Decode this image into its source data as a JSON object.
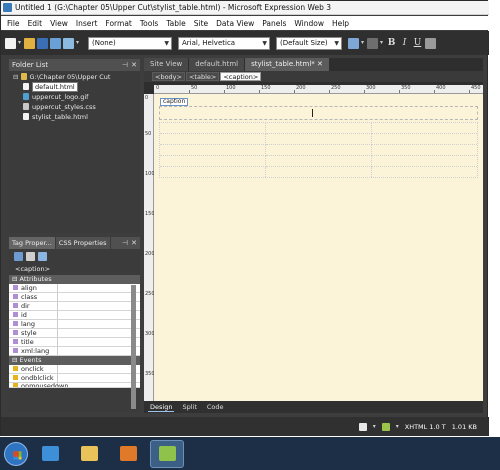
{
  "titlebar": {
    "title": "Untitled 1 (G:\\Chapter 05\\Upper Cut\\stylist_table.html) - Microsoft Expression Web 3"
  },
  "menu": [
    "File",
    "Edit",
    "View",
    "Insert",
    "Format",
    "Tools",
    "Table",
    "Site",
    "Data View",
    "Panels",
    "Window",
    "Help"
  ],
  "toolbar": {
    "style_select": "(None)",
    "font_select": "Arial, Helvetica",
    "size_select": "(Default Size)",
    "bold": "B",
    "italic": "I",
    "underline": "U"
  },
  "folder_list": {
    "title": "Folder List",
    "root": "G:\\Chapter 05\\Upper Cut",
    "files": [
      "default.html",
      "uppercut_logo.gif",
      "uppercut_styles.css",
      "stylist_table.html"
    ]
  },
  "tag_panel": {
    "tabs": [
      "Tag Proper...",
      "CSS Properties"
    ],
    "context": "<caption>",
    "attributes_header": "Attributes",
    "attributes": [
      "align",
      "class",
      "dir",
      "id",
      "lang",
      "style",
      "title",
      "xml:lang"
    ],
    "events_header": "Events",
    "events": [
      "onclick",
      "ondblclick",
      "onmousedown"
    ]
  },
  "doc_tabs": [
    "Site View",
    "default.html",
    "stylist_table.html*"
  ],
  "breadcrumb": [
    "<body>",
    "<table>",
    "<caption>"
  ],
  "ruler_top": [
    "0",
    "50",
    "100",
    "150",
    "200",
    "250",
    "300",
    "350",
    "400",
    "450"
  ],
  "ruler_left": [
    "0",
    "50",
    "100",
    "150",
    "200",
    "250",
    "300",
    "350"
  ],
  "caption_tag": "caption",
  "view_tabs": [
    "Design",
    "Split",
    "Code"
  ],
  "status": {
    "doctype": "XHTML 1.0 T",
    "size": "1.01 KB"
  },
  "colors": {
    "panel_bg": "#3b3b3b",
    "canvas_bg": "#fcf4d9",
    "taskbar": "#1c2f46",
    "selection": "#6b93c6"
  }
}
